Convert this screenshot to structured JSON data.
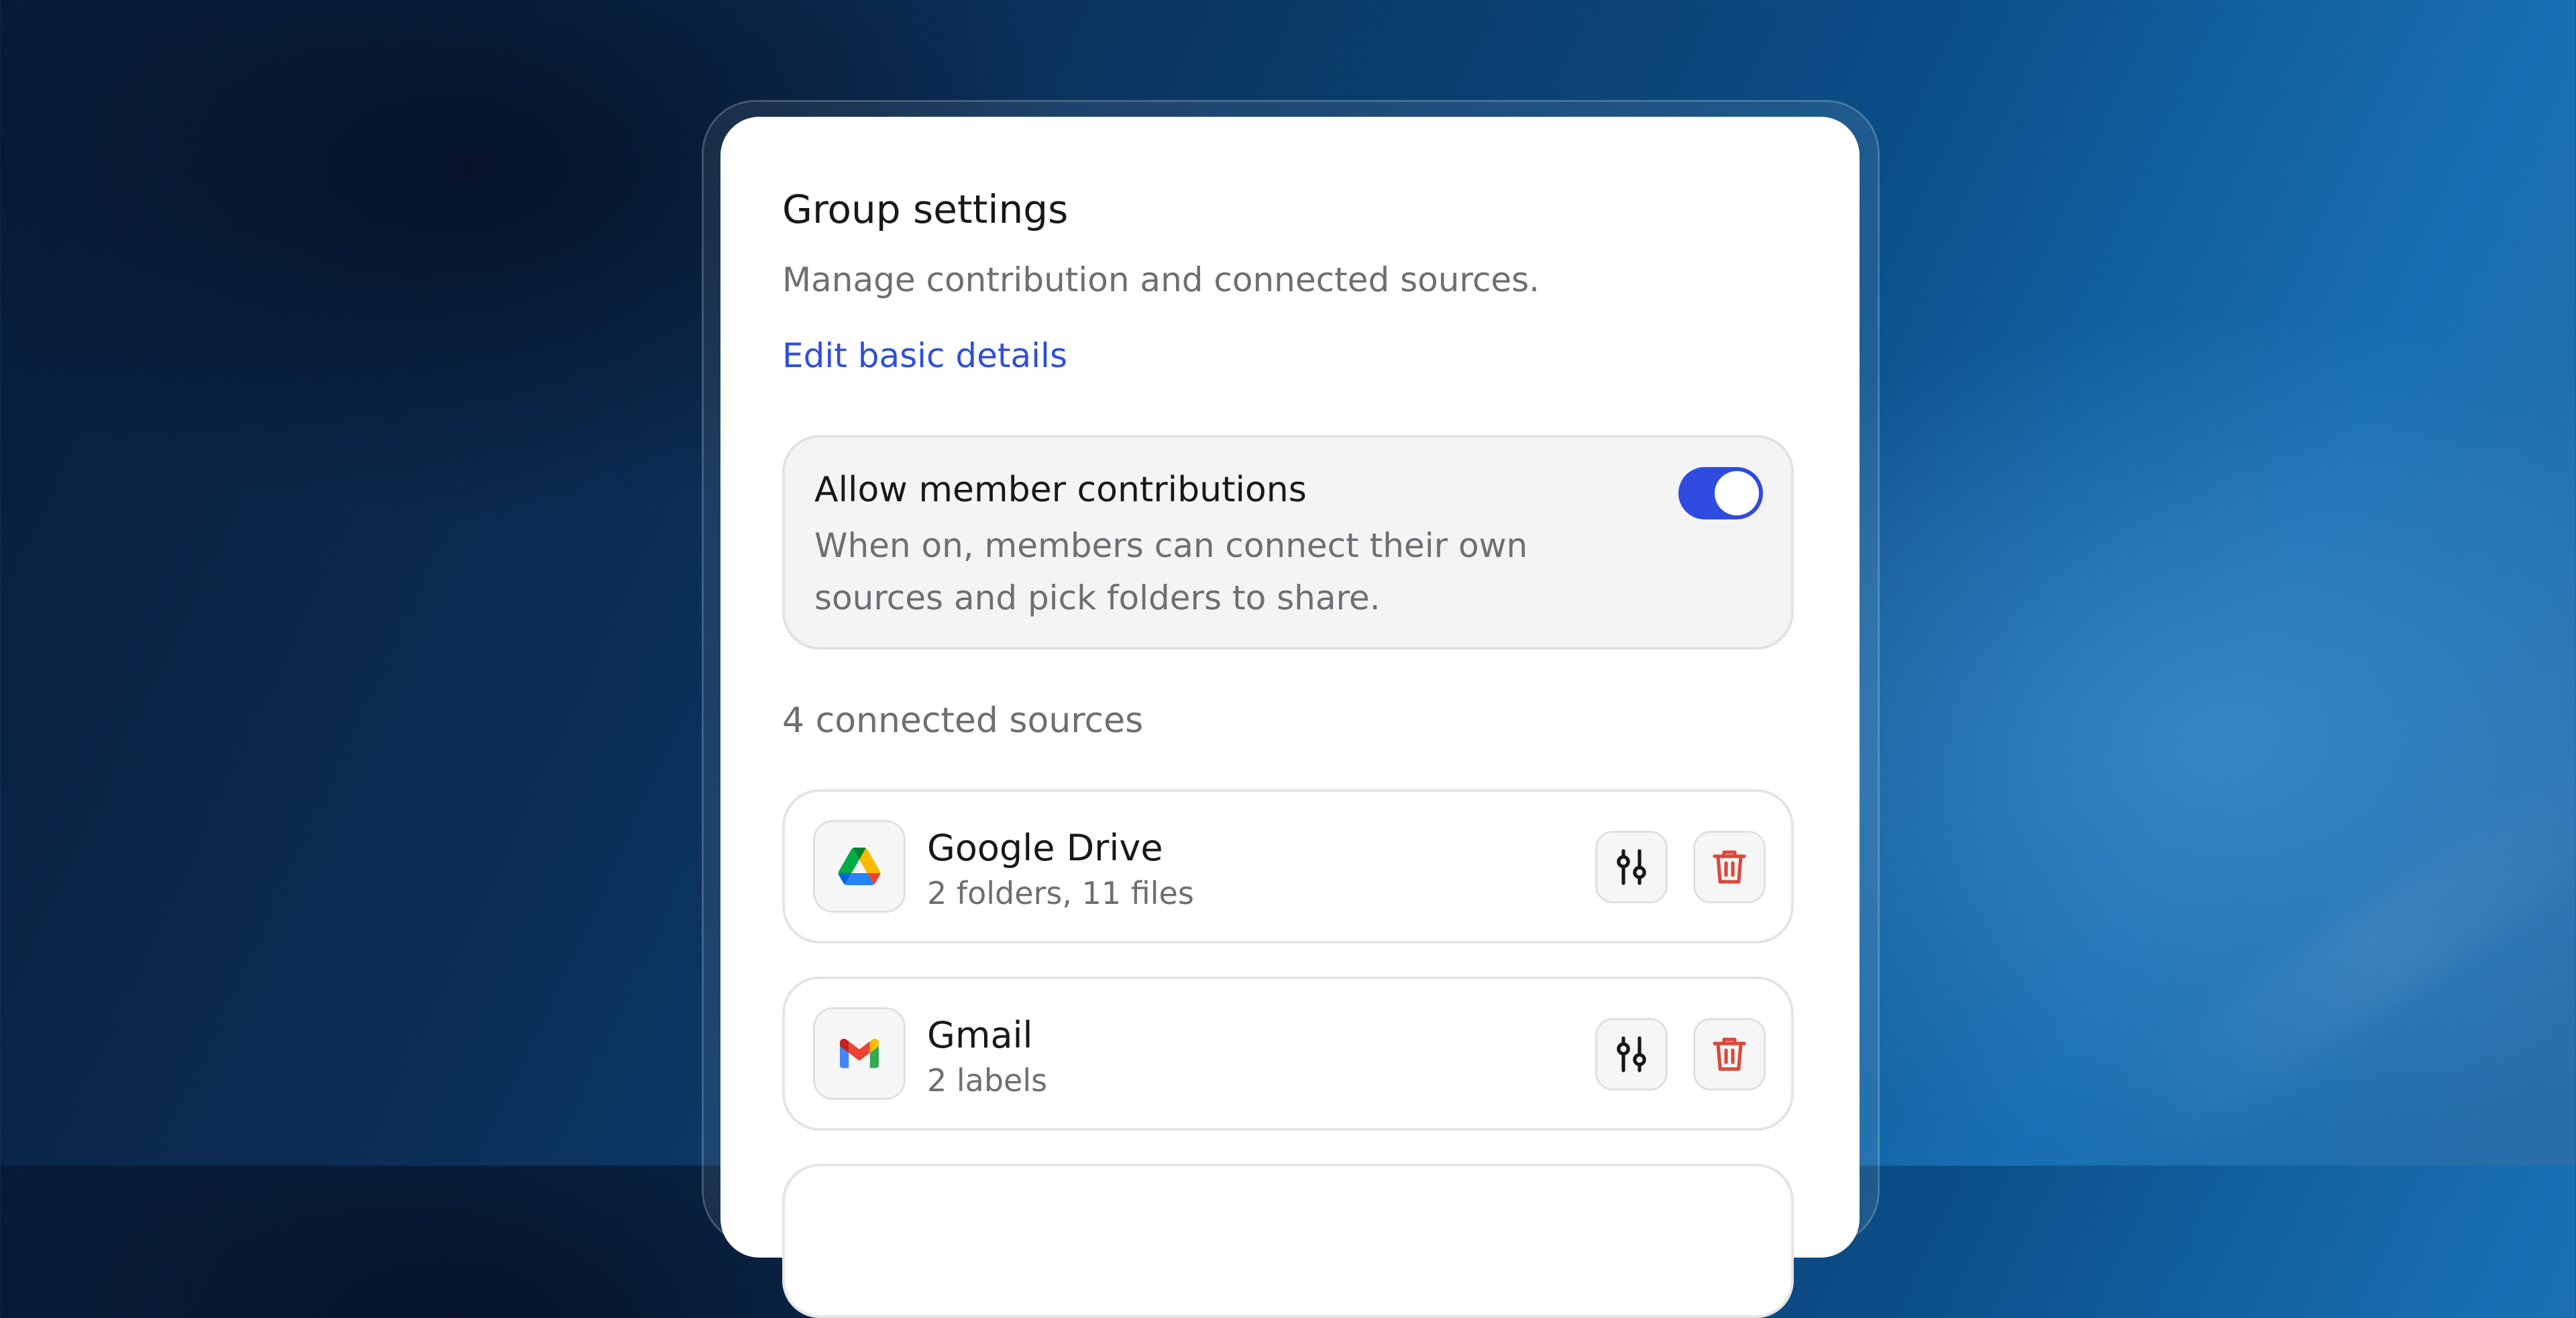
{
  "colors": {
    "accent": "#2f4fd9",
    "toggle_on": "#2f4be0",
    "danger": "#d94a3d",
    "muted_text": "#6e6e73"
  },
  "panel": {
    "title": "Group settings",
    "subtitle": "Manage contribution and connected sources.",
    "edit_link": "Edit basic details"
  },
  "contributions": {
    "title": "Allow member contributions",
    "description": "When on, members can connect their own sources and pick folders to share.",
    "enabled": true
  },
  "sources": {
    "count_label": "4 connected sources",
    "items": [
      {
        "name": "Google Drive",
        "meta": "2 folders, 11 files",
        "icon": "google-drive-icon"
      },
      {
        "name": "Gmail",
        "meta": "2 labels",
        "icon": "gmail-icon"
      }
    ],
    "action_icons": [
      "sliders-icon",
      "trash-icon"
    ]
  }
}
